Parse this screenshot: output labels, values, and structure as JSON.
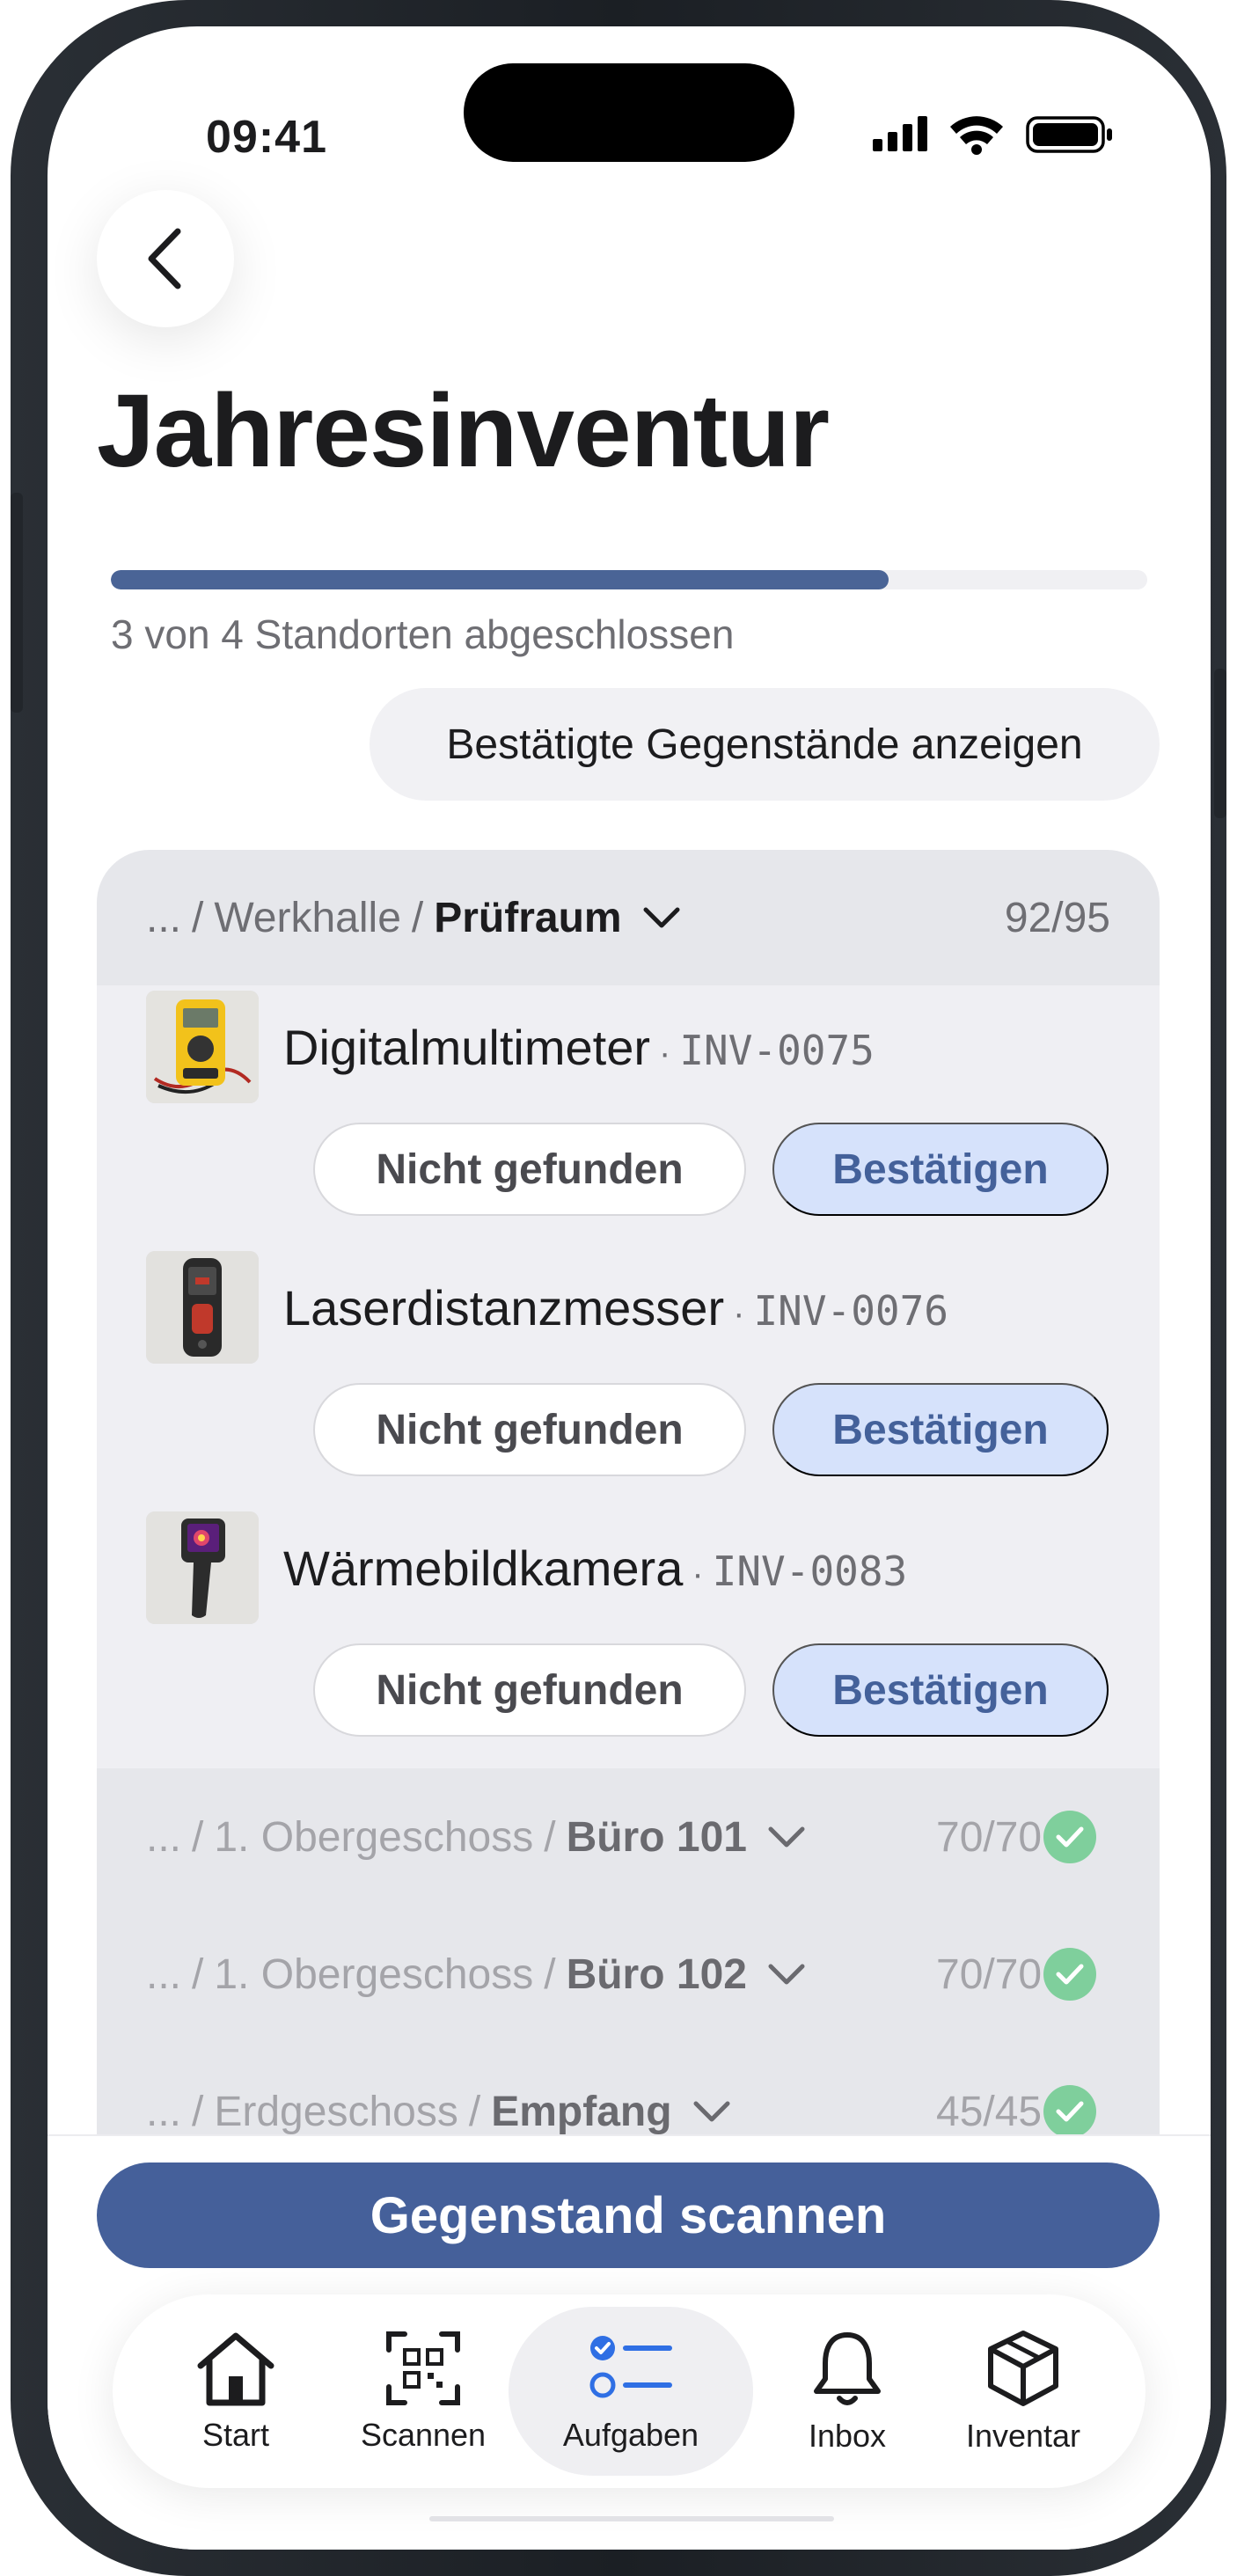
{
  "status_bar": {
    "time": "09:41"
  },
  "header": {
    "title": "Jahresinventur"
  },
  "progress": {
    "fraction": 0.75,
    "label": "3 von 4 Standorten abgeschlossen"
  },
  "show_confirmed_label": "Bestätigte Gegenstände anzeigen",
  "active_location": {
    "path_prefix": "...",
    "path_middle": "Werkhalle",
    "path_current": "Prüfraum",
    "count": "92/95"
  },
  "items": [
    {
      "name": "Digitalmultimeter",
      "code": "INV-0075",
      "thumb_icon": "multimeter-icon",
      "not_found_label": "Nicht gefunden",
      "confirm_label": "Bestätigen"
    },
    {
      "name": "Laserdistanzmesser",
      "code": "INV-0076",
      "thumb_icon": "laser-distance-meter-icon",
      "not_found_label": "Nicht gefunden",
      "confirm_label": "Bestätigen"
    },
    {
      "name": "Wärmebildkamera",
      "code": "INV-0083",
      "thumb_icon": "thermal-camera-icon",
      "not_found_label": "Nicht gefunden",
      "confirm_label": "Bestätigen"
    }
  ],
  "completed_locations": [
    {
      "path_prefix": "...",
      "path_middle": "1. Obergeschoss",
      "path_current": "Büro 101",
      "count": "70/70"
    },
    {
      "path_prefix": "...",
      "path_middle": "1. Obergeschoss",
      "path_current": "Büro 102",
      "count": "70/70"
    },
    {
      "path_prefix": "...",
      "path_middle": "Erdgeschoss",
      "path_current": "Empfang",
      "count": "45/45"
    }
  ],
  "scan_button_label": "Gegenstand scannen",
  "tabs": [
    {
      "label": "Start",
      "icon": "home-icon"
    },
    {
      "label": "Scannen",
      "icon": "qr-code-icon"
    },
    {
      "label": "Aufgaben",
      "icon": "task-list-icon",
      "active": true
    },
    {
      "label": "Inbox",
      "icon": "bell-icon"
    },
    {
      "label": "Inventar",
      "icon": "box-icon"
    }
  ],
  "colors": {
    "accent": "#45609a",
    "confirm_bg": "#d6e2fb",
    "success": "#7fcf9c",
    "card_bg": "#e6e7eb"
  }
}
